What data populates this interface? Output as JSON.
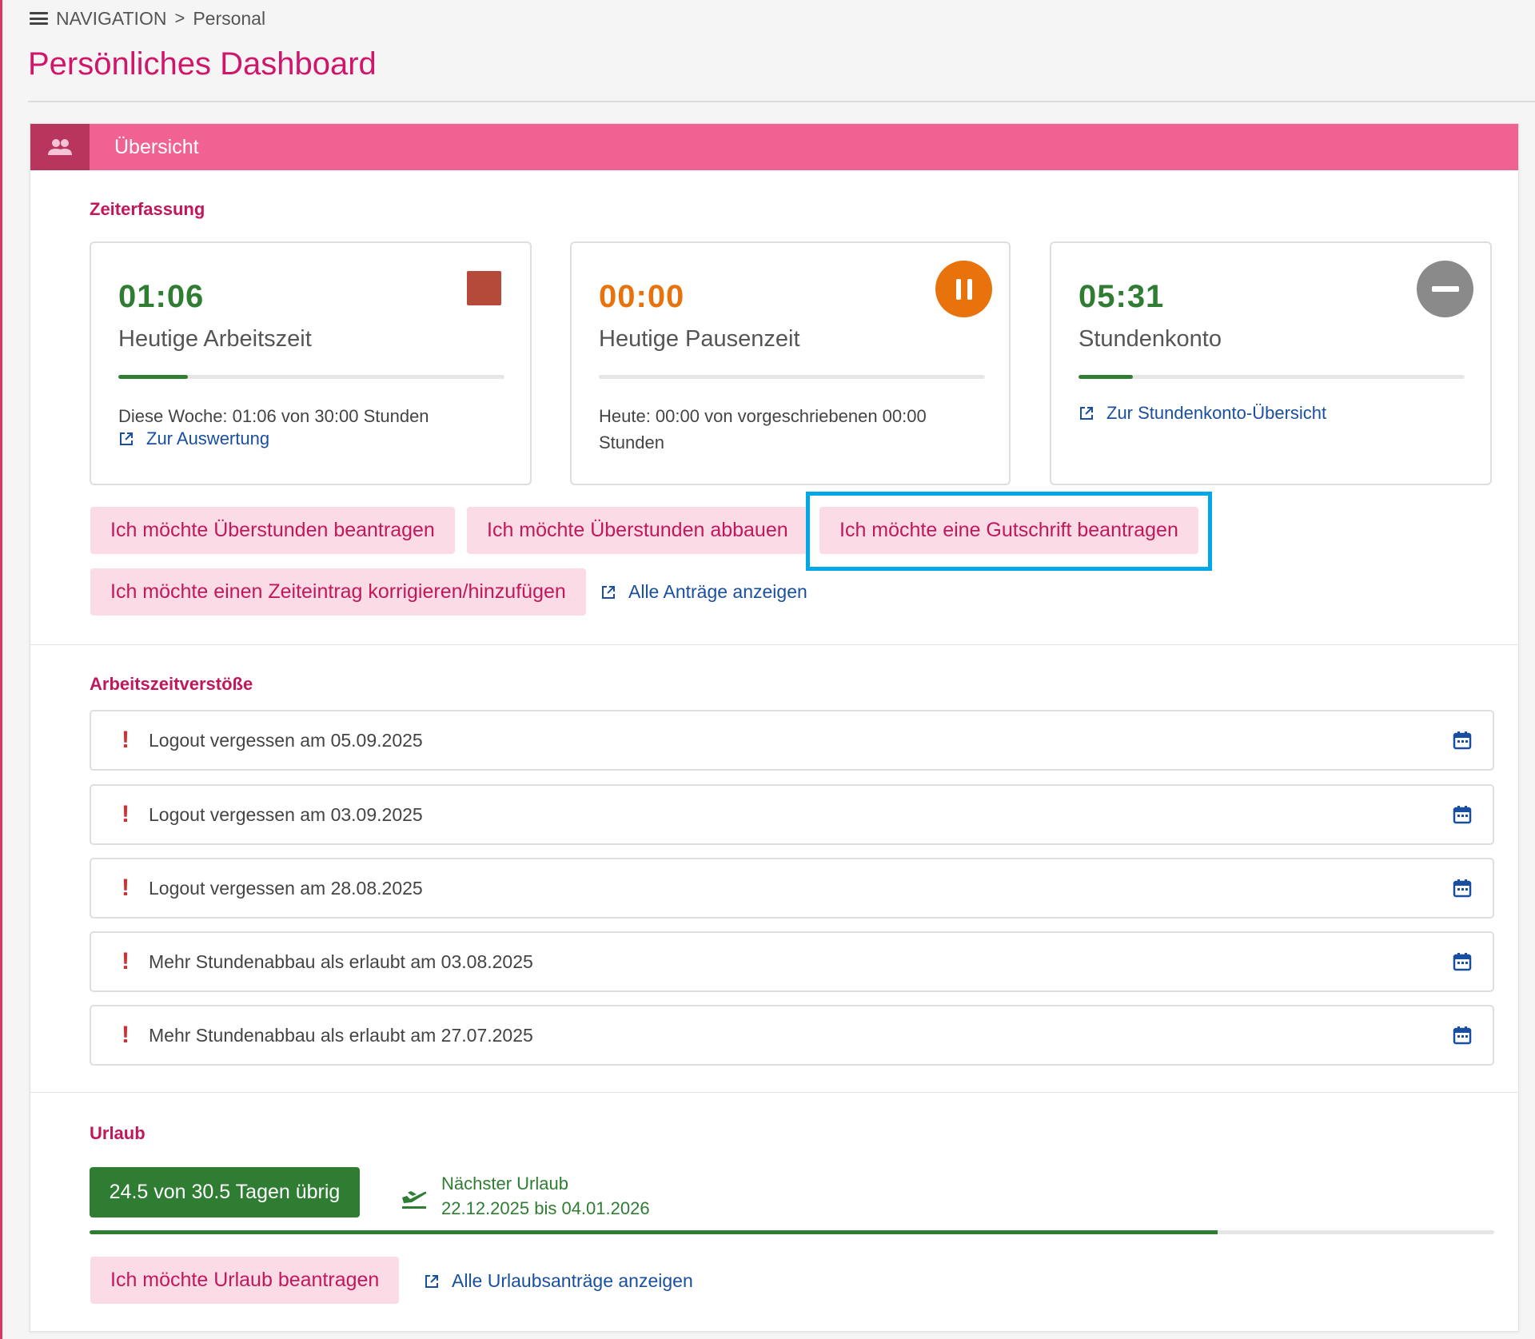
{
  "breadcrumb": {
    "root": "NAVIGATION",
    "separator": ">",
    "current": "Personal"
  },
  "page": {
    "title": "Persönliches Dashboard"
  },
  "overview": {
    "title": "Übersicht",
    "zeiterfassung": {
      "title": "Zeiterfassung",
      "work": {
        "value": "01:06",
        "label": "Heutige Arbeitszeit",
        "progress_percent": 18,
        "progress_color": "#2e7d32",
        "value_color": "#2e7d32",
        "info": "Diese Woche: 01:06 von 30:00 Stunden",
        "link": "Zur Auswertung",
        "action_icon": "stop-icon"
      },
      "pause": {
        "value": "00:00",
        "label": "Heutige Pausenzeit",
        "progress_percent": 0,
        "value_color": "#e8730c",
        "info": "Heute: 00:00 von vorgeschriebenen 00:00 Stunden",
        "action_icon": "pause-icon",
        "action_color": "#e8730c"
      },
      "account": {
        "value": "05:31",
        "label": "Stundenkonto",
        "progress_percent": 14,
        "progress_color": "#2e7d32",
        "value_color": "#2e7d32",
        "link": "Zur Stundenkonto-Übersicht",
        "action_icon": "minus-icon",
        "action_color": "#8a8a8a"
      },
      "buttons": {
        "overtime_request": "Ich möchte Überstunden beantragen",
        "overtime_reduce": "Ich möchte Überstunden abbauen",
        "credit_request": "Ich möchte eine Gutschrift beantragen",
        "correct_entry": "Ich möchte einen Zeiteintrag korrigieren/hinzufügen"
      },
      "all_requests_link": "Alle Anträge anzeigen"
    },
    "violations": {
      "title": "Arbeitszeitverstöße",
      "items": [
        {
          "text": "Logout vergessen am 05.09.2025"
        },
        {
          "text": "Logout vergessen am 03.09.2025"
        },
        {
          "text": "Logout vergessen am 28.08.2025"
        },
        {
          "text": "Mehr Stundenabbau als erlaubt am 03.08.2025"
        },
        {
          "text": "Mehr Stundenabbau als erlaubt am 27.07.2025"
        }
      ],
      "marker": "!"
    },
    "vacation": {
      "title": "Urlaub",
      "days_left": "24.5 von 30.5 Tagen übrig",
      "remaining_days": 24.5,
      "total_days": 30.5,
      "next_label": "Nächster Urlaub",
      "next_dates": "22.12.2025 bis 04.01.2026",
      "request_button": "Ich möchte Urlaub beantragen",
      "all_link": "Alle Urlaubsanträge anzeigen"
    }
  },
  "colors": {
    "accent": "#d0166a",
    "header_bg": "#f06292",
    "header_icon_bg": "#b8355e",
    "button_bg": "#fbdbe6",
    "link": "#1a4fa0",
    "success": "#2e7d32",
    "warning": "#e8730c",
    "highlight": "#00a8e8"
  }
}
